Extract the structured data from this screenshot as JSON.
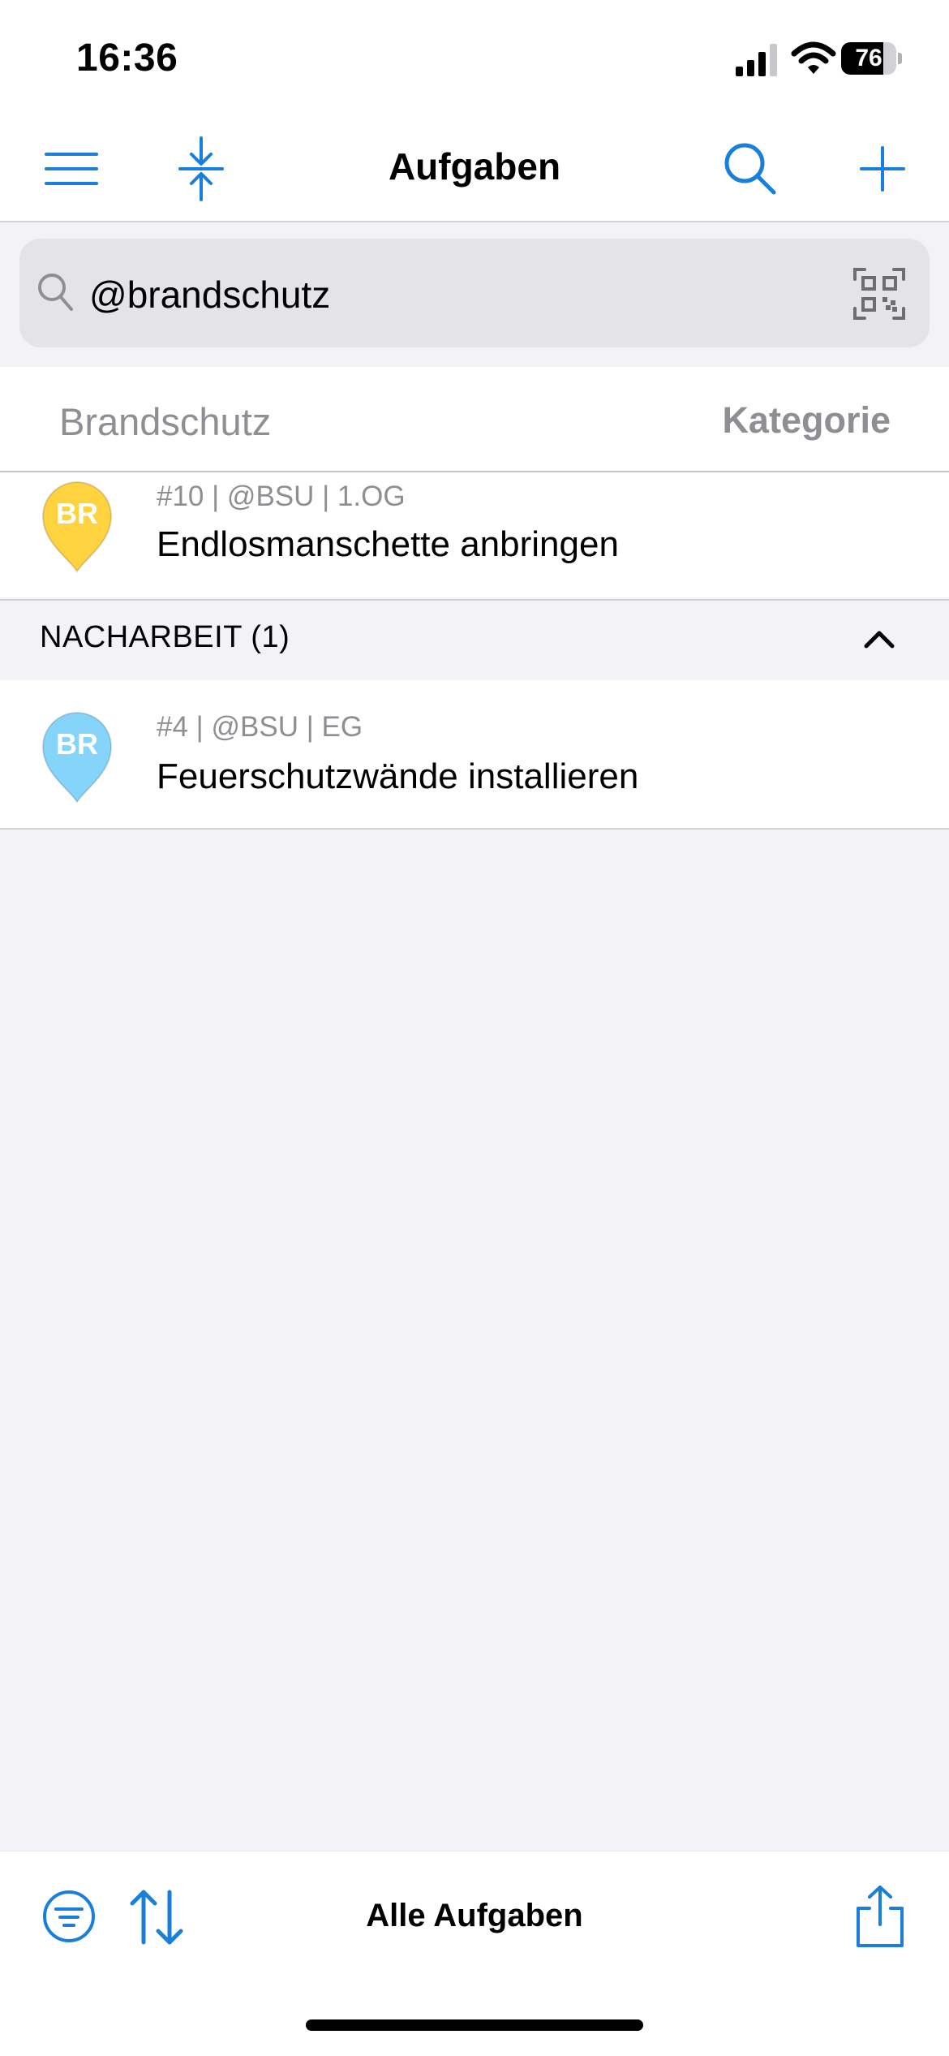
{
  "status_bar": {
    "time": "16:36",
    "battery_level": 76,
    "battery_text": "76"
  },
  "nav": {
    "title": "Aufgaben",
    "icons": [
      "menu-icon",
      "collapse-icon",
      "search-icon",
      "plus-icon"
    ]
  },
  "search": {
    "value": "@brandschutz"
  },
  "filter": {
    "left_label": "Brandschutz",
    "right_label": "Kategorie"
  },
  "tasks": [
    {
      "pin_label": "BR",
      "pin_color": "#ffd23f",
      "meta": "#10 | @BSU | 1.OG",
      "title": "Endlosmanschette anbringen"
    },
    {
      "pin_label": "BR",
      "pin_color": "#85d4fa",
      "meta": "#4 | @BSU | EG",
      "title": "Feuerschutzwände installieren"
    }
  ],
  "section": {
    "label": "NACHARBEIT (1)"
  },
  "toolbar": {
    "title": "Alle Aufgaben"
  },
  "colors": {
    "accent": "#1a7fd9",
    "background": "#f2f2f7"
  }
}
